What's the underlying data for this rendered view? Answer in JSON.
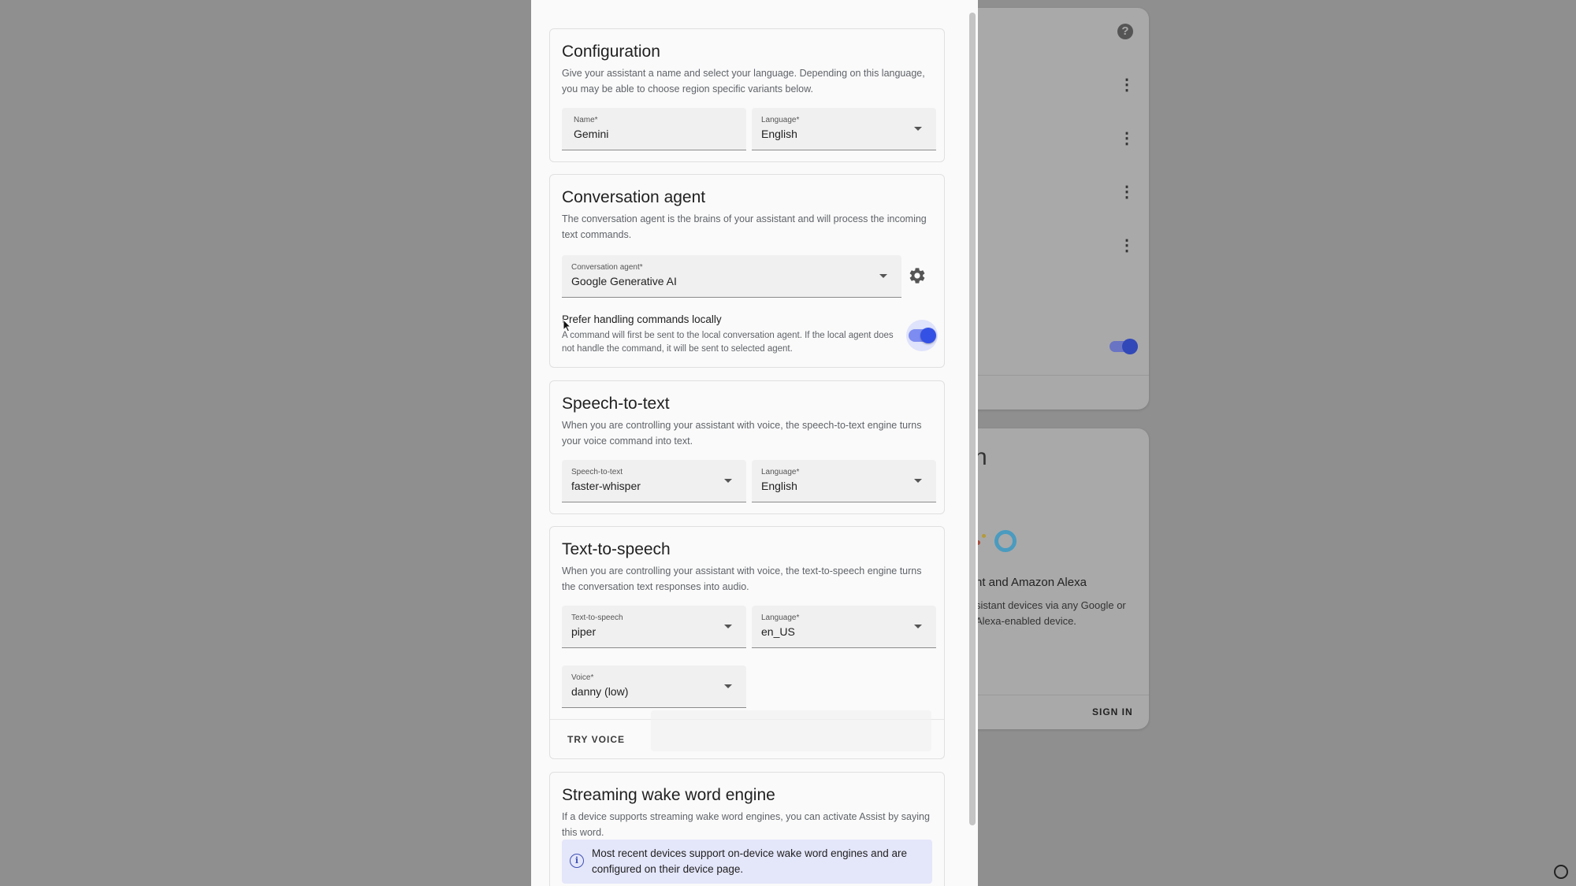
{
  "background": {
    "partial_heading": "h",
    "assistants_text": "nt and Amazon Alexa",
    "assistants_desc": "sistant devices via any Google or Alexa-enabled device.",
    "sign_in": "SIGN IN"
  },
  "configuration": {
    "title": "Configuration",
    "description": "Give your assistant a name and select your language. Depending on this language, you may be able to choose region specific variants below.",
    "name_label": "Name*",
    "name_value": "Gemini",
    "language_label": "Language*",
    "language_value": "English"
  },
  "conversation": {
    "title": "Conversation agent",
    "description": "The conversation agent is the brains of your assistant and will process the incoming text commands.",
    "agent_label": "Conversation agent*",
    "agent_value": "Google Generative AI",
    "prefer_local_title": "Prefer handling commands locally",
    "prefer_local_desc": "A command will first be sent to the local conversation agent. If the local agent does not handle the command, it will be sent to selected agent.",
    "prefer_local_on": true
  },
  "stt": {
    "title": "Speech-to-text",
    "description": "When you are controlling your assistant with voice, the speech-to-text engine turns your voice command into text.",
    "engine_label": "Speech-to-text",
    "engine_value": "faster-whisper",
    "language_label": "Language*",
    "language_value": "English"
  },
  "tts": {
    "title": "Text-to-speech",
    "description": "When you are controlling your assistant with voice, the text-to-speech engine turns the conversation text responses into audio.",
    "engine_label": "Text-to-speech",
    "engine_value": "piper",
    "language_label": "Language*",
    "language_value": "en_US",
    "voice_label": "Voice*",
    "voice_value": "danny (low)",
    "try_voice": "TRY VOICE"
  },
  "wake_word": {
    "title": "Streaming wake word engine",
    "description": "If a device supports streaming wake word engines, you can activate Assist by saying this word.",
    "info": "Most recent devices support on-device wake word engines and are configured on their device page."
  },
  "colors": {
    "accent": "#3451e6",
    "info_bg": "#e4e6fa"
  }
}
